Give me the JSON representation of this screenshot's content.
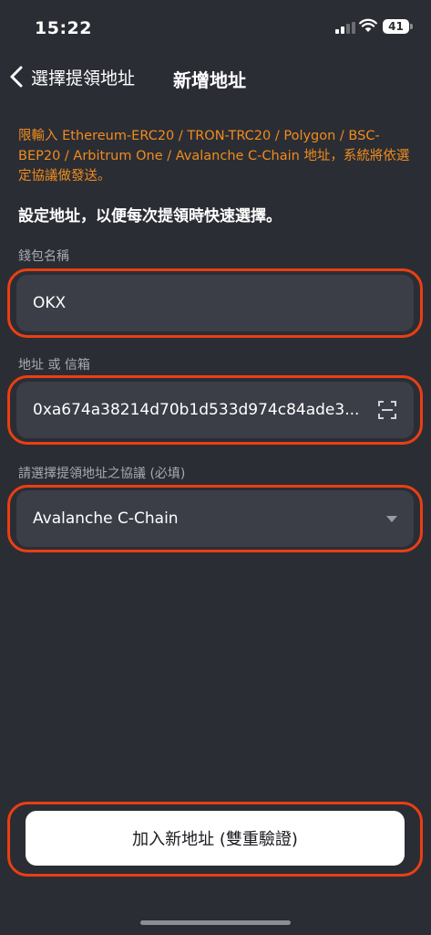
{
  "status_bar": {
    "time": "15:22",
    "battery": "41"
  },
  "nav": {
    "back_label": "選擇提領地址",
    "title": "新增地址"
  },
  "notice": "限輸入 Ethereum-ERC20 / TRON-TRC20 / Polygon / BSC-BEP20 / Arbitrum One / Avalanche C-Chain 地址，系統將依選定協議做發送。",
  "section_title": "設定地址，以便每次提領時快速選擇。",
  "wallet_name": {
    "label": "錢包名稱",
    "value": "OKX"
  },
  "address": {
    "label": "地址 或 信箱",
    "value": "0xa674a38214d70b1d533d974c84ade3..."
  },
  "protocol": {
    "label": "請選擇提領地址之協議 (必填)",
    "value": "Avalanche C-Chain"
  },
  "submit_label": "加入新地址 (雙重驗證)",
  "colors": {
    "background": "#2b2d34",
    "field": "#3b3e47",
    "notice": "#f08c1e",
    "highlight": "#ea3f13"
  }
}
